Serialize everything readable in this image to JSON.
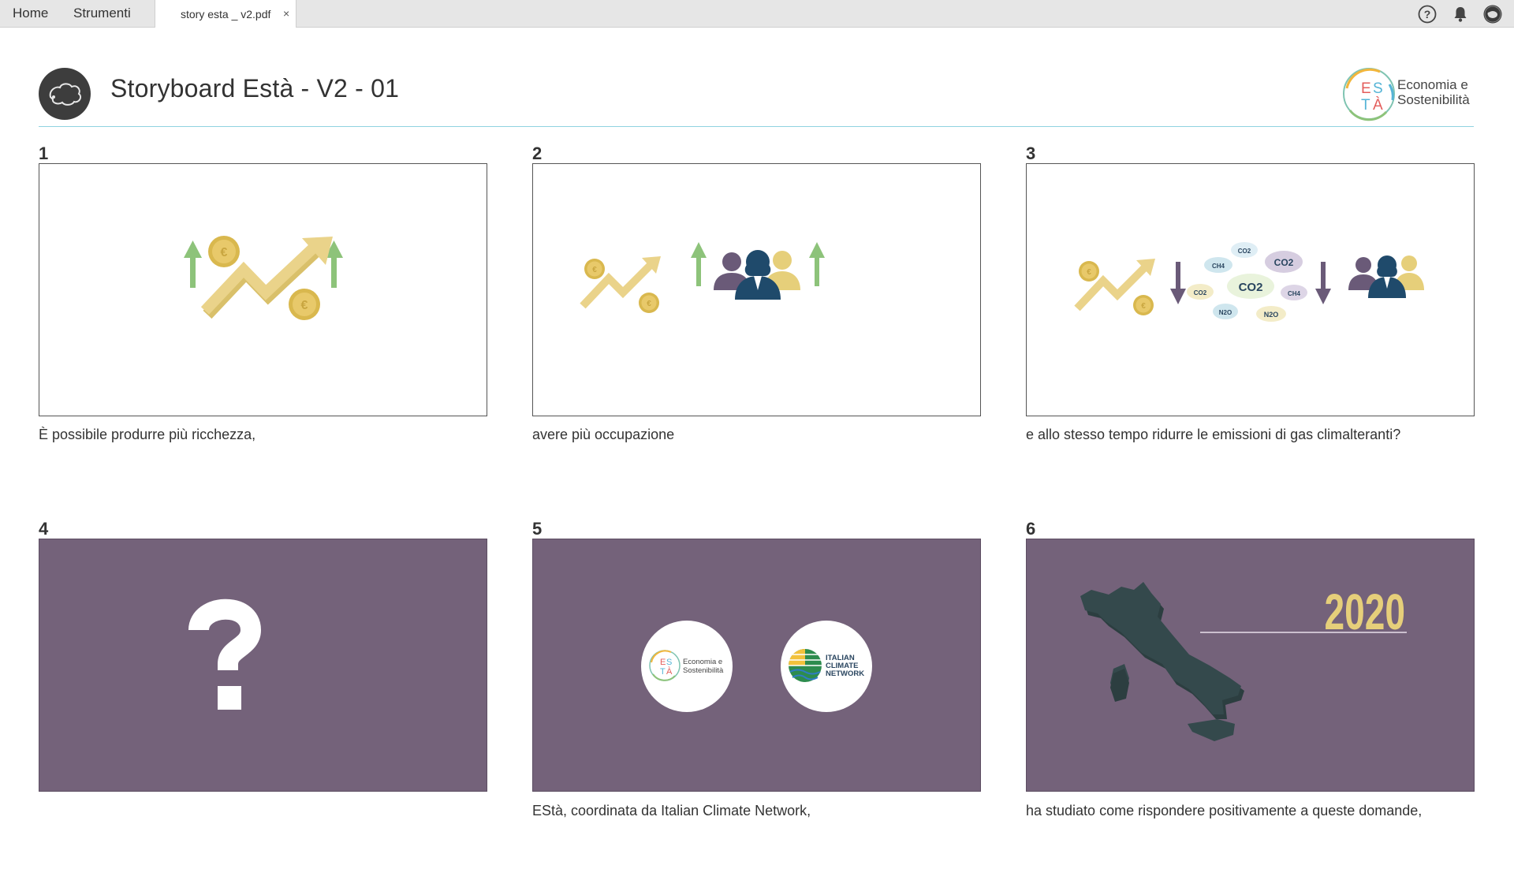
{
  "topbar": {
    "home_label": "Home",
    "tools_label": "Strumenti",
    "document_tab_title": "story esta _ v2.pdf",
    "close_symbol": "×",
    "icons": [
      "help-icon",
      "notification-bell-icon",
      "user-avatar-icon"
    ]
  },
  "header": {
    "title": "Storyboard Està - V2 - 01",
    "brand_logo_letters": [
      "E",
      "S",
      "T",
      "À"
    ],
    "brand_text_line1": "Economia e",
    "brand_text_line2": "Sostenibilità"
  },
  "panels": [
    {
      "number": "1",
      "caption": "È possibile produrre più ricchezza,",
      "background": "#ffffff",
      "icons": [
        "euro-coin-icon",
        "trend-up-arrow-icon",
        "green-up-arrow-icon"
      ]
    },
    {
      "number": "2",
      "caption": "avere più occupazione",
      "background": "#ffffff",
      "icons": [
        "euro-coin-icon",
        "trend-up-arrow-icon",
        "workers-group-icon",
        "green-up-arrow-icon"
      ]
    },
    {
      "number": "3",
      "caption": "e allo stesso tempo ridurre le emissioni di gas climalteranti?",
      "background": "#ffffff",
      "icons": [
        "trend-up-arrow-icon",
        "gas-clouds-icon",
        "purple-down-arrow-icon",
        "workers-group-icon"
      ]
    },
    {
      "number": "4",
      "caption": "",
      "background": "#74627a",
      "icons": [
        "question-mark-icon"
      ]
    },
    {
      "number": "5",
      "caption": "EStà, coordinata da Italian Climate Network,",
      "background": "#74627a",
      "icons": [
        "esta-logo-icon",
        "italian-climate-network-logo-icon"
      ]
    },
    {
      "number": "6",
      "caption": "ha studiato come rispondere positivamente a queste domande,",
      "background": "#74627a",
      "icons": [
        "italy-map-icon"
      ]
    }
  ],
  "panel3_gas_labels": [
    "CO2",
    "CO2",
    "CH4",
    "CO2",
    "CO2",
    "CH4",
    "N2O",
    "N2O"
  ],
  "panel5_logos": {
    "esta_line1": "Economia e",
    "esta_line2": "Sostenibilità",
    "icn_line1": "ITALIAN",
    "icn_line2": "CLIMATE",
    "icn_line3": "NETWORK"
  },
  "panel6_year": "2020",
  "colors": {
    "gold": "#e6cf7a",
    "green_arrow": "#8dc37a",
    "purple_panel": "#74627a",
    "navy_person": "#1f4a6b",
    "rule_cyan": "#8fd3e0",
    "italy_map": "#34494c"
  }
}
